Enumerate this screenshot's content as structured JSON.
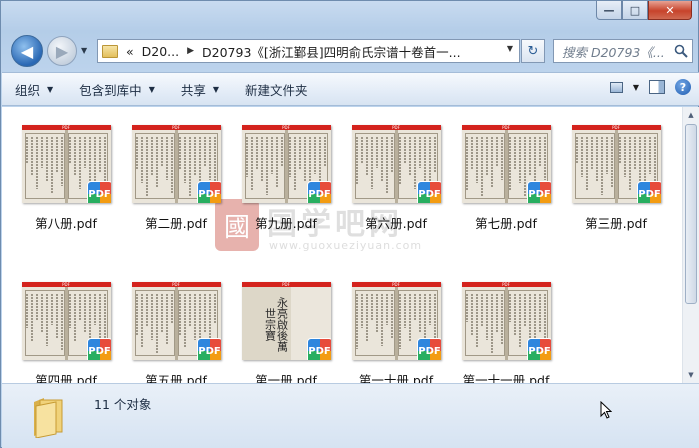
{
  "window": {
    "controls": {
      "minimize": "—",
      "maximize": "□",
      "close": "✕"
    }
  },
  "nav": {
    "back_glyph": "◀",
    "forward_glyph": "▶",
    "dropdown_glyph": "▼"
  },
  "address": {
    "overflow": "«",
    "crumbs": [
      "D20...",
      "D20793《[浙江鄞县]四明俞氏宗谱十卷首一..."
    ],
    "dropdown_glyph": "▼"
  },
  "refresh": {
    "glyph": "↻"
  },
  "search": {
    "placeholder": "搜索 D20793《..."
  },
  "toolbar": {
    "organize": "组织",
    "include_library": "包含到库中",
    "share": "共享",
    "new_folder": "新建文件夹",
    "dropdown_glyph": "▼",
    "help_glyph": "?"
  },
  "files": [
    {
      "name": "第八册.pdf",
      "thumb_style": "book"
    },
    {
      "name": "第二册.pdf",
      "thumb_style": "book"
    },
    {
      "name": "第九册.pdf",
      "thumb_style": "book"
    },
    {
      "name": "第六册.pdf",
      "thumb_style": "book"
    },
    {
      "name": "第七册.pdf",
      "thumb_style": "book"
    },
    {
      "name": "第三册.pdf",
      "thumb_style": "book"
    },
    {
      "name": "第四册.pdf",
      "thumb_style": "book"
    },
    {
      "name": "第五册.pdf",
      "thumb_style": "book"
    },
    {
      "name": "第一册.pdf",
      "thumb_style": "cover"
    },
    {
      "name": "第一十册.pdf",
      "thumb_style": "book"
    },
    {
      "name": "第一十一册.pdf",
      "thumb_style": "book"
    }
  ],
  "thumb_label": "PDF",
  "badge_label": "PDF",
  "cover_text": "永亮啟後萬世宗寶",
  "watermark": {
    "logo_char": "國",
    "title": "国学吧网",
    "url": "www.guoxueziyuan.com"
  },
  "status": {
    "item_count": "11 个对象"
  },
  "colors": {
    "pdf_red": "#d4231d",
    "accent": "#2a68b4"
  }
}
